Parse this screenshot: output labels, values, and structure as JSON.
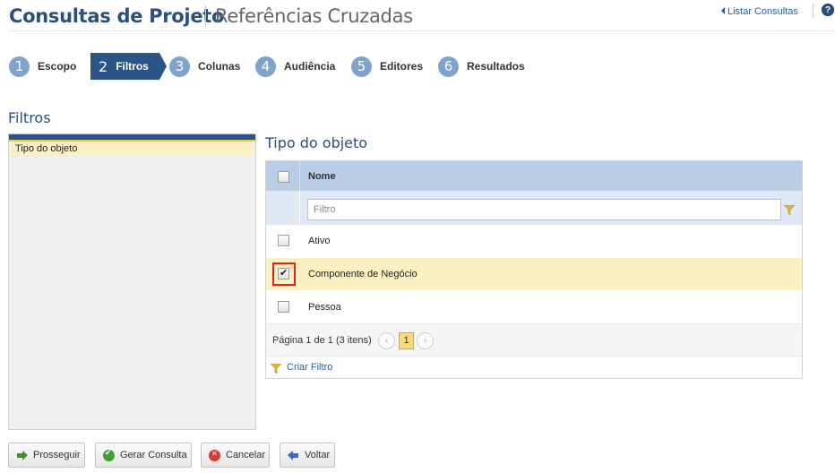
{
  "header": {
    "title": "Consultas de Projeto",
    "subtitle": "Referências Cruzadas",
    "list_link": "Listar Consultas",
    "help": "?"
  },
  "steps": [
    {
      "num": "1",
      "label": "Escopo",
      "active": false
    },
    {
      "num": "2",
      "label": "Filtros",
      "active": true
    },
    {
      "num": "3",
      "label": "Colunas",
      "active": false
    },
    {
      "num": "4",
      "label": "Audiência",
      "active": false
    },
    {
      "num": "5",
      "label": "Editores",
      "active": false
    },
    {
      "num": "6",
      "label": "Resultados",
      "active": false
    }
  ],
  "left_panel": {
    "title": "Filtros",
    "items": [
      "Tipo do objeto"
    ]
  },
  "main": {
    "title": "Tipo do objeto",
    "column_header": "Nome",
    "filter_placeholder": "Filtro",
    "filter_value": "",
    "rows": [
      {
        "name": "Ativo",
        "checked": false
      },
      {
        "name": "Componente de Negócio",
        "checked": true
      },
      {
        "name": "Pessoa",
        "checked": false
      }
    ],
    "pagination": {
      "text": "Página 1 de 1 (3 itens)",
      "prev": "‹",
      "current": "1",
      "next": "›"
    },
    "create_filter": "Criar Filtro"
  },
  "buttons": {
    "proceed": "Prosseguir",
    "generate": "Gerar Consulta",
    "cancel": "Cancelar",
    "back": "Voltar"
  },
  "colors": {
    "brand": "#2b4f7e",
    "step_active": "#2d5487",
    "step_bubble": "#7fa3cf",
    "selection": "#fbf0c2",
    "highlight": "#e02020"
  }
}
